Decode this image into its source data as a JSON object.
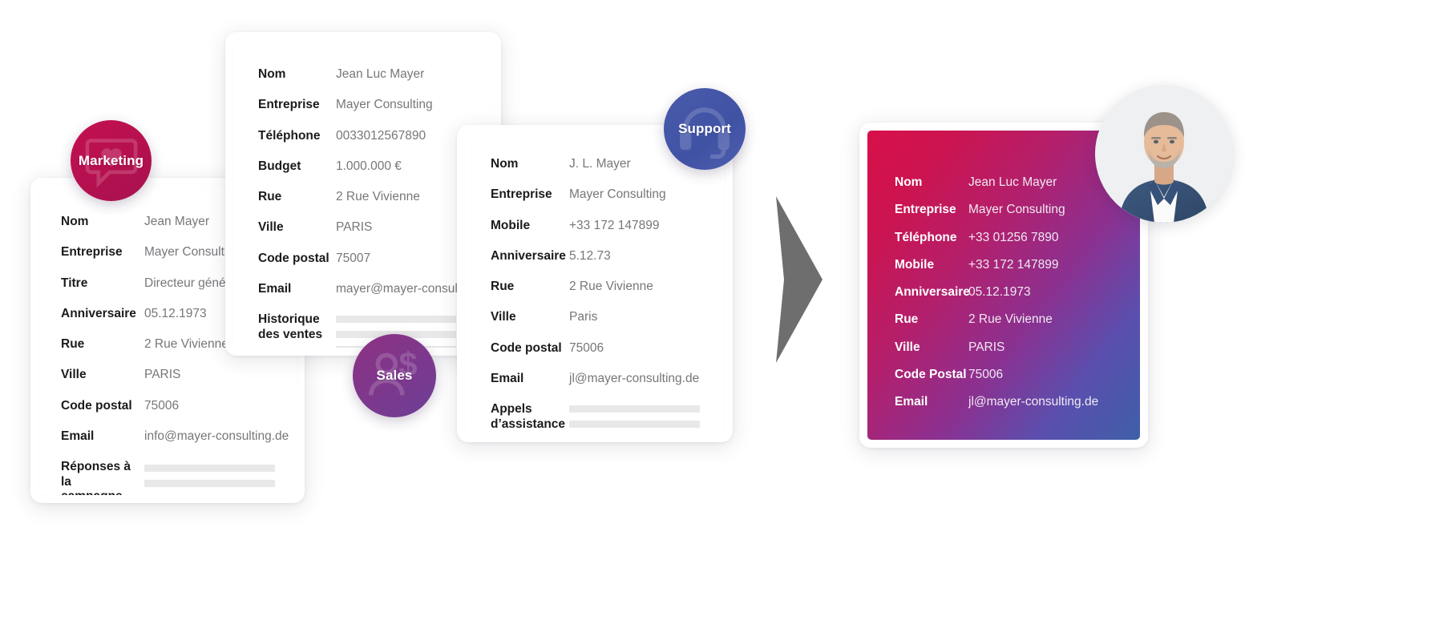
{
  "cards": [
    {
      "id": "marketing-card",
      "badge": {
        "label": "Marketing",
        "icon": "chat-heart-icon",
        "color": "#c41050"
      },
      "rows": [
        {
          "key": "Nom",
          "value": "Jean Mayer"
        },
        {
          "key": "Entreprise",
          "value": "Mayer Consulting"
        },
        {
          "key": "Titre",
          "value": "Directeur général"
        },
        {
          "key": "Anniversaire",
          "value": "05.12.1973"
        },
        {
          "key": "Rue",
          "value": "2 Rue Vivienne"
        },
        {
          "key": "Ville",
          "value": "PARIS"
        },
        {
          "key": "Code postal",
          "value": "75006"
        },
        {
          "key": "Email",
          "value": "info@mayer-consulting.de"
        },
        {
          "key": "Réponses à la\ncampagne",
          "value": "",
          "bars": 4
        }
      ]
    },
    {
      "id": "sales-card",
      "badge": {
        "label": "Sales",
        "icon": "user-dollar-icon",
        "color": "#8e3183"
      },
      "rows": [
        {
          "key": "Nom",
          "value": "Jean Luc Mayer"
        },
        {
          "key": "Entreprise",
          "value": "Mayer Consulting"
        },
        {
          "key": "Téléphone",
          "value": "0033012567890"
        },
        {
          "key": "Budget",
          "value": "1.000.000 €"
        },
        {
          "key": "Rue",
          "value": "2 Rue Vivienne"
        },
        {
          "key": "Ville",
          "value": "PARIS"
        },
        {
          "key": "Code postal",
          "value": "75007"
        },
        {
          "key": "Email",
          "value": "mayer@mayer-consulting.de"
        },
        {
          "key": "Historique\ndes ventes",
          "value": "",
          "bars": 4
        }
      ]
    },
    {
      "id": "support-card",
      "badge": {
        "label": "Support",
        "icon": "headset-icon",
        "color": "#4a5bab"
      },
      "rows": [
        {
          "key": "Nom",
          "value": "J. L. Mayer"
        },
        {
          "key": "Entreprise",
          "value": "Mayer Consulting"
        },
        {
          "key": "Mobile",
          "value": "+33 172 147899"
        },
        {
          "key": "Anniversaire",
          "value": "5.12.73"
        },
        {
          "key": "Rue",
          "value": "2 Rue Vivienne"
        },
        {
          "key": "Ville",
          "value": "Paris"
        },
        {
          "key": "Code postal",
          "value": "75006"
        },
        {
          "key": "Email",
          "value": "jl@mayer-consulting.de"
        },
        {
          "key": "Appels\nd’assistance",
          "value": "",
          "bars": 4
        }
      ]
    },
    {
      "id": "unified-card",
      "gradient": {
        "from": "#d8104a",
        "mid": "#8c3090",
        "to": "#3f5fa8"
      },
      "rows": [
        {
          "key": "Nom",
          "value": "Jean Luc Mayer"
        },
        {
          "key": "Entreprise",
          "value": "Mayer Consulting"
        },
        {
          "key": "Téléphone",
          "value": "+33 01256 7890"
        },
        {
          "key": "Mobile",
          "value": "+33 172 147899"
        },
        {
          "key": "Anniversaire",
          "value": "05.12.1973"
        },
        {
          "key": "Rue",
          "value": "2 Rue Vivienne"
        },
        {
          "key": "Ville",
          "value": "PARIS"
        },
        {
          "key": "Code Postal",
          "value": "75006"
        },
        {
          "key": "Email",
          "value": "jl@mayer-consulting.de"
        }
      ]
    }
  ],
  "arrow": {
    "icon": "chevron-right-arrow",
    "color": "#6e6e6e"
  },
  "avatar": {
    "icon": "person-photo",
    "alt": "Jean Luc Mayer"
  }
}
